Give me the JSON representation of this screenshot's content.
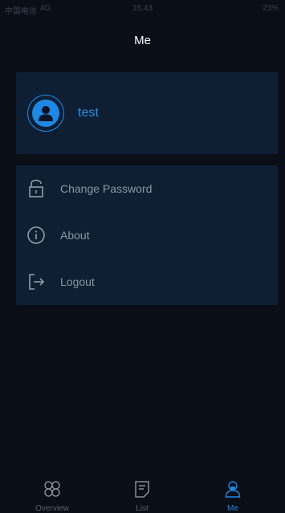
{
  "status_bar": {
    "carrier": "中国电信",
    "network": "4G",
    "time": "15:43",
    "battery": "23%"
  },
  "header": {
    "title": "Me"
  },
  "profile": {
    "username": "test"
  },
  "menu": {
    "items": [
      {
        "label": "Change Password",
        "icon": "lock-icon"
      },
      {
        "label": "About",
        "icon": "info-icon"
      },
      {
        "label": "Logout",
        "icon": "logout-icon"
      }
    ]
  },
  "tab_bar": {
    "tabs": [
      {
        "label": "Overview",
        "icon": "overview-icon",
        "active": false
      },
      {
        "label": "List",
        "icon": "list-icon",
        "active": false
      },
      {
        "label": "Me",
        "icon": "user-icon",
        "active": true
      }
    ]
  },
  "colors": {
    "background": "#0a0e16",
    "card": "#0e1f33",
    "accent": "#1f88e5",
    "muted_text": "#8d96a3"
  }
}
